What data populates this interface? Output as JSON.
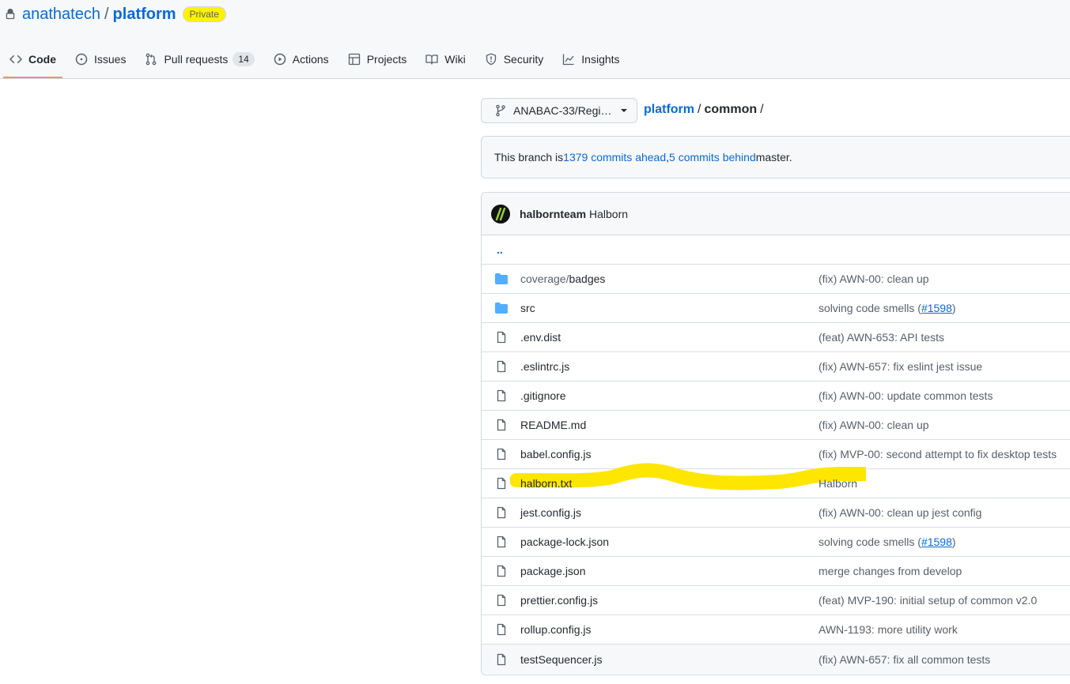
{
  "header": {
    "owner": "anathatech",
    "separator": "/",
    "repo": "platform",
    "visibility_badge": "Private"
  },
  "tabs": [
    {
      "label": "Code",
      "icon": "code-icon",
      "active": true
    },
    {
      "label": "Issues",
      "icon": "issue-opened-icon"
    },
    {
      "label": "Pull requests",
      "icon": "git-pull-request-icon",
      "counter": "14"
    },
    {
      "label": "Actions",
      "icon": "play-icon"
    },
    {
      "label": "Projects",
      "icon": "table-icon"
    },
    {
      "label": "Wiki",
      "icon": "book-icon"
    },
    {
      "label": "Security",
      "icon": "shield-icon"
    },
    {
      "label": "Insights",
      "icon": "graph-icon"
    }
  ],
  "branch_selector": {
    "label": "ANABAC-33/Regi…",
    "icon": "git-branch-icon"
  },
  "breadcrumb": {
    "root": "platform",
    "sep": "/",
    "current": "common",
    "trailing_sep": "/"
  },
  "branch_info": {
    "prefix": "This branch is ",
    "ahead": "1379 commits ahead",
    "comma": ", ",
    "behind": "5 commits behind",
    "suffix": " master."
  },
  "latest_commit": {
    "author": "halbornteam",
    "message": "Halborn"
  },
  "parent_dir_link": "..",
  "files": [
    {
      "type": "dir",
      "prefix": "coverage/",
      "name": "badges",
      "message": "(fix) AWN-00: clean up"
    },
    {
      "type": "dir",
      "prefix": "",
      "name": "src",
      "message": "solving code smells (",
      "link": "#1598",
      "message_end": ")"
    },
    {
      "type": "file",
      "prefix": "",
      "name": ".env.dist",
      "message": "(feat) AWN-653: API tests"
    },
    {
      "type": "file",
      "prefix": "",
      "name": ".eslintrc.js",
      "message": "(fix) AWN-657: fix eslint jest issue"
    },
    {
      "type": "file",
      "prefix": "",
      "name": ".gitignore",
      "message": "(fix) AWN-00: update common tests"
    },
    {
      "type": "file",
      "prefix": "",
      "name": "README.md",
      "message": "(fix) AWN-00: clean up"
    },
    {
      "type": "file",
      "prefix": "",
      "name": "babel.config.js",
      "message": "(fix) MVP-00: second attempt to fix desktop tests"
    },
    {
      "type": "file",
      "prefix": "",
      "name": "halborn.txt",
      "message": "Halborn",
      "highlighted": true
    },
    {
      "type": "file",
      "prefix": "",
      "name": "jest.config.js",
      "message": "(fix) AWN-00: clean up jest config"
    },
    {
      "type": "file",
      "prefix": "",
      "name": "package-lock.json",
      "message": "solving code smells (",
      "link": "#1598",
      "message_end": ")"
    },
    {
      "type": "file",
      "prefix": "",
      "name": "package.json",
      "message": "merge changes from develop"
    },
    {
      "type": "file",
      "prefix": "",
      "name": "prettier.config.js",
      "message": "(feat) MVP-190: initial setup of common v2.0"
    },
    {
      "type": "file",
      "prefix": "",
      "name": "rollup.config.js",
      "message": "AWN-1193: more utility work"
    },
    {
      "type": "file",
      "prefix": "",
      "name": "testSequencer.js",
      "message": "(fix) AWN-657: fix all common tests"
    }
  ],
  "colors": {
    "link": "#0969da",
    "highlight": "#fff200",
    "active_tab_underline": "#fd8c73",
    "folder": "#54aeff"
  }
}
